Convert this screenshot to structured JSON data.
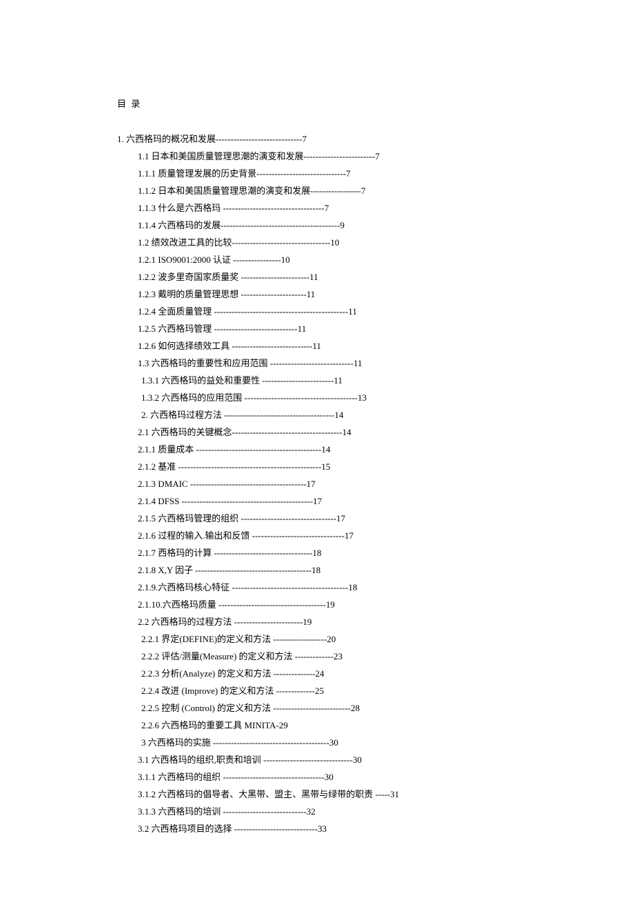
{
  "title": "目 录",
  "entries": [
    {
      "indent": "ind0",
      "text": "1.  六西格玛的概况和发展-----------------------------7"
    },
    {
      "indent": "ind1",
      "text": "1.1 日本和美国质量管理思潮的演变和发展------------------------7"
    },
    {
      "indent": "ind1",
      "text": "1.1.1 质量管理发展的历史背景------------------------------7"
    },
    {
      "indent": "ind1",
      "text": "1.1.2 日本和美国质量管理思潮的演变和发展-----------------7"
    },
    {
      "indent": "ind1",
      "text": "1.1.3 什么是六西格玛 ----------------------------------7"
    },
    {
      "indent": "ind1",
      "text": "1.1.4 六西格玛的发展----------------------------------------9"
    },
    {
      "indent": "ind1",
      "text": "1.2 绩效改进工具的比较---------------------------------10"
    },
    {
      "indent": "ind1",
      "text": "1.2.1 ISO9001:2000 认证 ----------------10"
    },
    {
      "indent": "ind1",
      "text": "1.2.2 波多里奇国家质量奖 -----------------------11"
    },
    {
      "indent": "ind1",
      "text": "1.2.3 戴明的质量管理思想 ----------------------11"
    },
    {
      "indent": "ind1",
      "text": "1.2.4 全面质量管理 ---------------------------------------------11"
    },
    {
      "indent": "ind1",
      "text": "1.2.5 六西格玛管理 ----------------------------11"
    },
    {
      "indent": "ind1",
      "text": "1.2.6 如何选择绩效工具 ---------------------------11"
    },
    {
      "indent": "ind1",
      "text": "1.3 六西格玛的重要性和应用范围 ----------------------------11"
    },
    {
      "indent": "ind2",
      "text": "1.3.1 六西格玛的益处和重要性 ------------------------11"
    },
    {
      "indent": "ind2",
      "text": "1.3.2 六西格玛的应用范围 --------------------------------------13"
    },
    {
      "indent": "ind2",
      "text": "2. 六西格玛过程方法 -------------------------------------14"
    },
    {
      "indent": "ind1",
      "text": "2.1 六西格玛的关键概念-------------------------------------14"
    },
    {
      "indent": "ind1",
      "text": "2.1.1 质量成本 ------------------------------------------14"
    },
    {
      "indent": "ind1",
      "text": "2.1.2 基准 ------------------------------------------------15"
    },
    {
      "indent": "ind1",
      "text": "2.1.3 DMAIC ---------------------------------------17"
    },
    {
      "indent": "ind1",
      "text": "2.1.4 DFSS --------------------------------------------17"
    },
    {
      "indent": "ind1",
      "text": "2.1.5 六西格玛管理的组织 --------------------------------17"
    },
    {
      "indent": "ind1",
      "text": "2.1.6 过程的输入.输出和反馈 -------------------------------17"
    },
    {
      "indent": "ind1",
      "text": "2.1.7 西格玛的计算 ---------------------------------18"
    },
    {
      "indent": "ind1",
      "text": "2.1.8 X,Y 因子 ---------------------------------------18"
    },
    {
      "indent": "ind1",
      "text": "2.1.9.六西格玛核心特征 ---------------------------------------18"
    },
    {
      "indent": "ind1",
      "text": "2.1.10.六西格玛质量 ------------------------------------19"
    },
    {
      "indent": "ind1",
      "text": "2.2 六西格玛的过程方法 -----------------------19"
    },
    {
      "indent": "ind2",
      "text": "2.2.1 界定(DEFINE)的定义和方法 ------------------20"
    },
    {
      "indent": "ind2",
      "text": "2.2.2 评估/测量(Measure) 的定义和方法 -------------23"
    },
    {
      "indent": "ind2",
      "text": "2.2.3 分析(Analyze) 的定义和方法 --------------24"
    },
    {
      "indent": "ind2",
      "text": "2.2.4 改进 (Improve) 的定义和方法 -------------25"
    },
    {
      "indent": "ind2",
      "text": "2.2.5 控制 (Control) 的定义和方法 --------------------------28"
    },
    {
      "indent": "ind2",
      "text": "2.2.6 六西格玛的重要工具 MINITA-29"
    },
    {
      "indent": "ind2",
      "text": "3 六西格玛的实施 ---------------------------------------30"
    },
    {
      "indent": "ind1",
      "text": "3.1 六西格玛的组织,职责和培训 ------------------------------30"
    },
    {
      "indent": "ind1",
      "text": "3.1.1 六西格玛的组织 ----------------------------------30"
    },
    {
      "indent": "ind1",
      "text": "3.1.2 六西格玛的倡导者、大黑带、盟主、黑带与绿带的职责 -----31"
    },
    {
      "indent": "ind1",
      "text": "3.1.3 六西格玛的培训 ----------------------------32"
    },
    {
      "indent": "ind1",
      "text": "3.2 六西格玛项目的选择 ----------------------------33"
    }
  ]
}
